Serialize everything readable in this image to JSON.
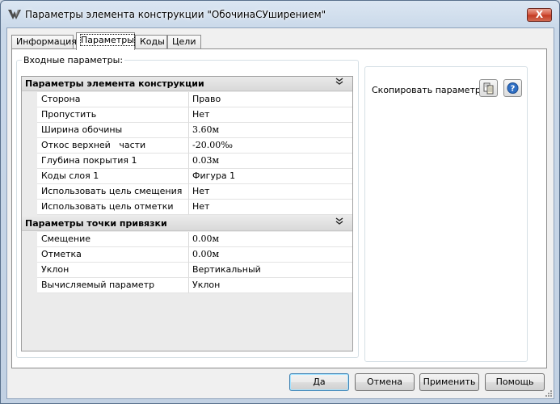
{
  "window": {
    "title": "Параметры элемента конструкции \"ОбочинаСУширением\"",
    "close_label": "X"
  },
  "tabs": [
    {
      "label": "Информация"
    },
    {
      "label": "Параметры",
      "active": true
    },
    {
      "label": "Коды"
    },
    {
      "label": "Цели"
    }
  ],
  "input_params": {
    "group_label": "Входные параметры:",
    "sections": [
      {
        "title": "Параметры элемента конструкции",
        "rows": [
          {
            "name": "Сторона",
            "value": "Право"
          },
          {
            "name": "Пропустить",
            "value": "Нет"
          },
          {
            "name": "Ширина обочины",
            "value": "3.60м"
          },
          {
            "name": "Откос верхней   части",
            "value": "-20.00‰"
          },
          {
            "name": "Глубина покрытия 1",
            "value": "0.03м"
          },
          {
            "name": "Коды слоя 1",
            "value": "Фигура 1"
          },
          {
            "name": "Использовать цель смещения",
            "value": "Нет"
          },
          {
            "name": "Использовать цель отметки",
            "value": "Нет"
          }
        ]
      },
      {
        "title": "Параметры точки привязки",
        "rows": [
          {
            "name": "Смещение",
            "value": "0.00м"
          },
          {
            "name": "Отметка",
            "value": "0.00м"
          },
          {
            "name": "Уклон",
            "value": "Вертикальный"
          },
          {
            "name": "Вычисляемый параметр",
            "value": "Уклон"
          }
        ]
      }
    ]
  },
  "copy_panel": {
    "label": "Скопировать параметры",
    "copy_icon": "copy-params-icon",
    "help_icon": "help-icon"
  },
  "buttons": {
    "ok": "Да",
    "cancel": "Отмена",
    "apply": "Применить",
    "help": "Помощь"
  },
  "colors": {
    "title_bar": "#c9d8e9",
    "close_button": "#c33a22",
    "section_header": "#dedede",
    "help_icon": "#2f6fc4"
  }
}
